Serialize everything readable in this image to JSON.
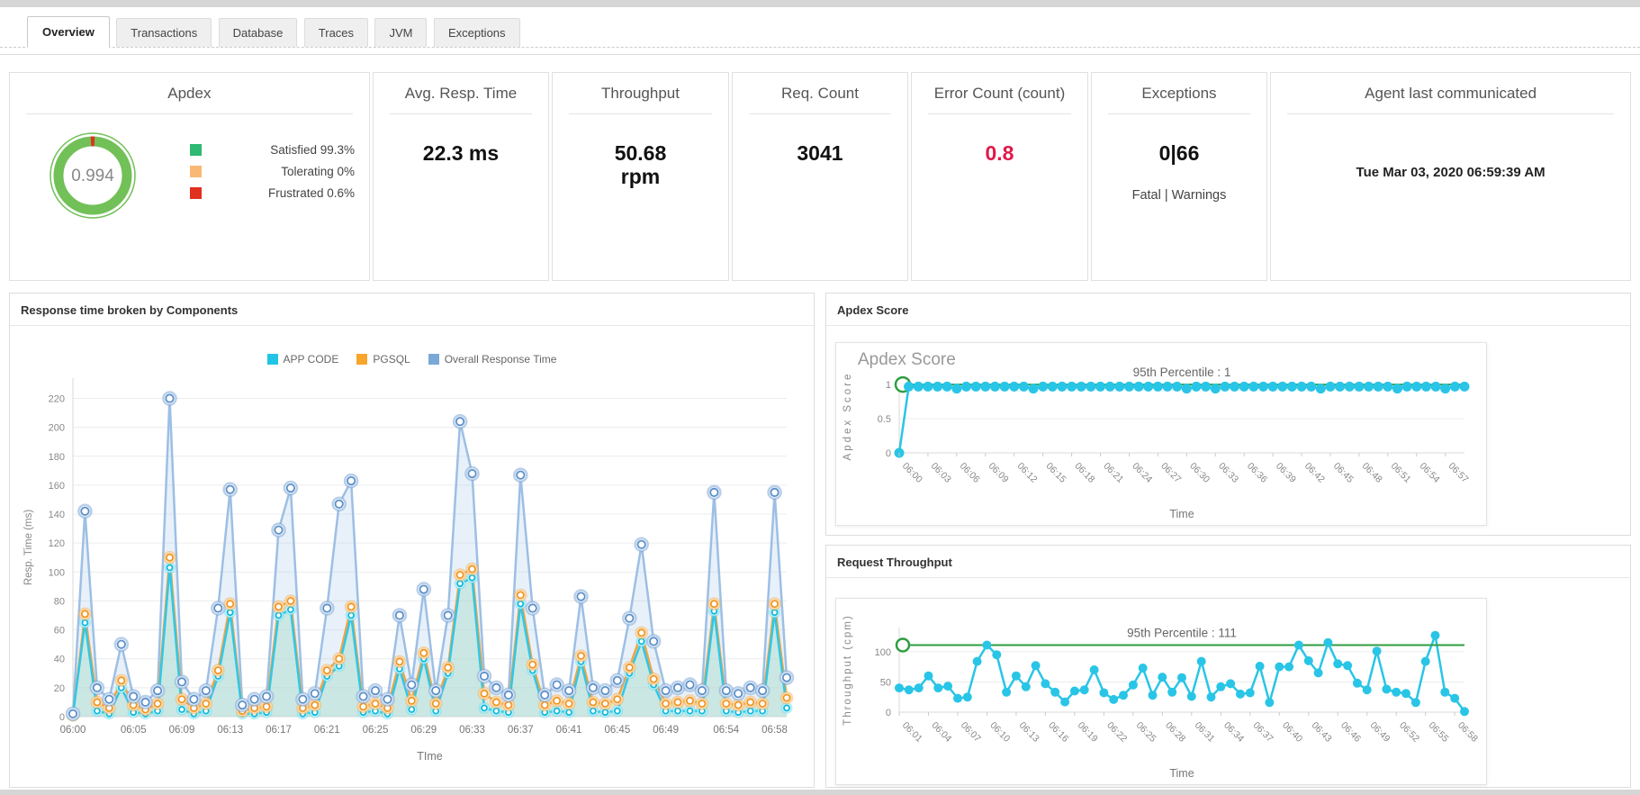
{
  "tabs": [
    {
      "label": "Overview",
      "active": true
    },
    {
      "label": "Transactions",
      "active": false
    },
    {
      "label": "Database",
      "active": false
    },
    {
      "label": "Traces",
      "active": false
    },
    {
      "label": "JVM",
      "active": false
    },
    {
      "label": "Exceptions",
      "active": false
    }
  ],
  "kpis": {
    "apdex": {
      "title": "Apdex",
      "donut": {
        "value": "0.994",
        "ring_color": "#72c058",
        "sliver_color": "#e0301e"
      },
      "legend": [
        {
          "label": "Satisfied 99.3%",
          "color": "#2eb872"
        },
        {
          "label": "Tolerating 0%",
          "color": "#f9b874"
        },
        {
          "label": "Frustrated 0.6%",
          "color": "#e0301e"
        }
      ]
    },
    "avg_resp": {
      "title": "Avg. Resp. Time",
      "value": "22.3 ms"
    },
    "throughput": {
      "title": "Throughput",
      "value": "50.68",
      "unit": "rpm"
    },
    "req_count": {
      "title": "Req. Count",
      "value": "3041"
    },
    "error_count": {
      "title": "Error Count (count)",
      "value": "0.8",
      "color": "#e0194a"
    },
    "exceptions": {
      "title": "Exceptions",
      "value": "0|66",
      "sub": "Fatal | Warnings"
    },
    "agent": {
      "title": "Agent last communicated",
      "value": "Tue Mar 03, 2020 06:59:39 AM"
    }
  },
  "panels": {
    "components": {
      "title": "Response time broken by Components"
    },
    "apdex_score": {
      "title": "Apdex Score",
      "inner_title": "Apdex Score"
    },
    "request_throughput": {
      "title": "Request Throughput"
    }
  },
  "chart_data": [
    {
      "type": "line",
      "title": "Response time broken by Components",
      "xlabel": "TIme",
      "ylabel": "Resp. Time (ms)",
      "ylim": [
        0,
        234
      ],
      "yticks": [
        0,
        20,
        40,
        60,
        80,
        100,
        120,
        140,
        160,
        180,
        200,
        220
      ],
      "grid": true,
      "legend_position": "top",
      "rotate_labels": false,
      "categories": [
        "06:00",
        "06:01",
        "06:02",
        "06:03",
        "06:04",
        "06:05",
        "06:06",
        "06:07",
        "06:08",
        "06:09",
        "06:10",
        "06:11",
        "06:12",
        "06:13",
        "06:14",
        "06:15",
        "06:16",
        "06:17",
        "06:18",
        "06:19",
        "06:20",
        "06:21",
        "06:22",
        "06:23",
        "06:24",
        "06:25",
        "06:26",
        "06:27",
        "06:28",
        "06:29",
        "06:30",
        "06:31",
        "06:32",
        "06:33",
        "06:34",
        "06:35",
        "06:36",
        "06:37",
        "06:38",
        "06:39",
        "06:40",
        "06:41",
        "06:42",
        "06:43",
        "06:44",
        "06:45",
        "06:46",
        "06:47",
        "06:48",
        "06:49",
        "06:50",
        "06:51",
        "06:52",
        "06:53",
        "06:54",
        "06:55",
        "06:56",
        "06:57",
        "06:58",
        "06:59"
      ],
      "label_indices": [
        0,
        5,
        9,
        13,
        17,
        21,
        25,
        29,
        33,
        37,
        41,
        45,
        49,
        54,
        58
      ],
      "legend": [
        {
          "name": "APP CODE",
          "color": "#22c4e6"
        },
        {
          "name": "PGSQL",
          "color": "#f7a52b"
        },
        {
          "name": "Overall Response Time",
          "color": "#7aa9d8"
        }
      ],
      "series": [
        {
          "name": "Overall Response Time",
          "color": "#9dbfe4",
          "marker": "ring",
          "marker_color": "#5a8fc8",
          "halo": "rgba(130,170,215,0.55)",
          "halo_r": 7,
          "ring_r": 4.2,
          "fill": "rgba(150,190,230,0.22)",
          "values": [
            2,
            142,
            20,
            12,
            50,
            14,
            10,
            18,
            220,
            24,
            12,
            18,
            75,
            157,
            8,
            12,
            14,
            129,
            158,
            12,
            16,
            75,
            147,
            163,
            14,
            18,
            12,
            70,
            22,
            88,
            18,
            70,
            204,
            168,
            28,
            20,
            15,
            167,
            75,
            15,
            22,
            18,
            83,
            20,
            18,
            25,
            68,
            119,
            52,
            18,
            20,
            22,
            18,
            155,
            18,
            16,
            20,
            18,
            155,
            27
          ]
        },
        {
          "name": "PGSQL",
          "color": "#f3a43f",
          "marker": "ring",
          "marker_color": "#ef9623",
          "halo": "rgba(248,175,80,0.5)",
          "halo_r": 6,
          "ring_r": 3.6,
          "fill": "rgba(250,195,120,0.28)",
          "values": [
            1,
            71,
            10,
            6,
            25,
            8,
            5,
            9,
            110,
            12,
            6,
            9,
            32,
            78,
            4,
            6,
            7,
            76,
            80,
            6,
            8,
            32,
            40,
            76,
            7,
            9,
            6,
            38,
            11,
            44,
            9,
            34,
            98,
            102,
            16,
            10,
            8,
            84,
            36,
            8,
            11,
            9,
            42,
            10,
            9,
            12,
            34,
            58,
            26,
            9,
            10,
            11,
            9,
            78,
            9,
            8,
            10,
            9,
            78,
            13
          ]
        },
        {
          "name": "APP CODE",
          "color": "#2fc8e8",
          "marker": "ring",
          "marker_color": "#10b9dd",
          "halo": "rgba(100,220,240,0.45)",
          "halo_r": 5.2,
          "ring_r": 3,
          "fill": "rgba(150,235,248,0.4)",
          "values": [
            1,
            65,
            4,
            2,
            20,
            3,
            2,
            4,
            103,
            5,
            2,
            4,
            28,
            72,
            2,
            2,
            3,
            70,
            74,
            2,
            3,
            28,
            35,
            70,
            3,
            4,
            2,
            33,
            5,
            40,
            4,
            30,
            92,
            96,
            6,
            4,
            3,
            78,
            32,
            3,
            4,
            3,
            38,
            4,
            3,
            4,
            30,
            52,
            22,
            4,
            4,
            4,
            4,
            73,
            4,
            3,
            4,
            4,
            72,
            6
          ]
        }
      ]
    },
    {
      "type": "line",
      "title": "Apdex Score",
      "xlabel": "Time",
      "ylabel": "Apdex Score",
      "ylim": [
        0,
        1.08
      ],
      "yticks": [
        0,
        0.5,
        1
      ],
      "grid": true,
      "rotate_labels": true,
      "percentile": {
        "value": 1,
        "label": "95th Percentile : 1",
        "color": "#2f9e41",
        "marker_r": 8
      },
      "categories": [
        "06:00",
        "06:01",
        "06:02",
        "06:03",
        "06:04",
        "06:05",
        "06:06",
        "06:07",
        "06:08",
        "06:09",
        "06:10",
        "06:11",
        "06:12",
        "06:13",
        "06:14",
        "06:15",
        "06:16",
        "06:17",
        "06:18",
        "06:19",
        "06:20",
        "06:21",
        "06:22",
        "06:23",
        "06:24",
        "06:25",
        "06:26",
        "06:27",
        "06:28",
        "06:29",
        "06:30",
        "06:31",
        "06:32",
        "06:33",
        "06:34",
        "06:35",
        "06:36",
        "06:37",
        "06:38",
        "06:39",
        "06:40",
        "06:41",
        "06:42",
        "06:43",
        "06:44",
        "06:45",
        "06:46",
        "06:47",
        "06:48",
        "06:49",
        "06:50",
        "06:51",
        "06:52",
        "06:53",
        "06:54",
        "06:55",
        "06:56",
        "06:57",
        "06:58",
        "06:59"
      ],
      "label_indices": [
        0,
        3,
        6,
        9,
        12,
        15,
        18,
        21,
        24,
        27,
        30,
        33,
        36,
        39,
        42,
        45,
        48,
        51,
        54,
        57
      ],
      "series": [
        {
          "name": "Apdex Score",
          "color": "#29c5e6",
          "marker": "dot",
          "marker_r": 5.5,
          "values": [
            0,
            0.97,
            0.97,
            0.97,
            0.97,
            0.97,
            0.94,
            0.97,
            0.97,
            0.97,
            0.97,
            0.97,
            0.97,
            0.97,
            0.94,
            0.97,
            0.97,
            0.97,
            0.97,
            0.97,
            0.97,
            0.97,
            0.97,
            0.97,
            0.97,
            0.97,
            0.97,
            0.97,
            0.97,
            0.97,
            0.94,
            0.97,
            0.97,
            0.94,
            0.97,
            0.97,
            0.97,
            0.97,
            0.97,
            0.97,
            0.97,
            0.97,
            0.97,
            0.97,
            0.94,
            0.97,
            0.97,
            0.97,
            0.97,
            0.97,
            0.97,
            0.97,
            0.94,
            0.97,
            0.97,
            0.97,
            0.97,
            0.94,
            0.97,
            0.97
          ]
        }
      ]
    },
    {
      "type": "line",
      "title": "Request Throughput",
      "xlabel": "Time",
      "ylabel": "Throughput (cpm)",
      "ylim": [
        0,
        140
      ],
      "yticks": [
        0,
        50,
        100
      ],
      "grid": true,
      "rotate_labels": true,
      "percentile": {
        "value": 111,
        "label": "95th Percentile : 111",
        "color": "#2f9e41",
        "marker_r": 7
      },
      "categories": [
        "06:01",
        "06:02",
        "06:03",
        "06:04",
        "06:05",
        "06:06",
        "06:07",
        "06:08",
        "06:09",
        "06:10",
        "06:11",
        "06:12",
        "06:13",
        "06:14",
        "06:15",
        "06:16",
        "06:17",
        "06:18",
        "06:19",
        "06:20",
        "06:21",
        "06:22",
        "06:23",
        "06:24",
        "06:25",
        "06:26",
        "06:27",
        "06:28",
        "06:29",
        "06:30",
        "06:31",
        "06:32",
        "06:33",
        "06:34",
        "06:35",
        "06:36",
        "06:37",
        "06:38",
        "06:39",
        "06:40",
        "06:41",
        "06:42",
        "06:43",
        "06:44",
        "06:45",
        "06:46",
        "06:47",
        "06:48",
        "06:49",
        "06:50",
        "06:51",
        "06:52",
        "06:53",
        "06:54",
        "06:55",
        "06:56",
        "06:57",
        "06:58",
        "06:59"
      ],
      "label_indices": [
        0,
        3,
        6,
        9,
        12,
        15,
        18,
        21,
        24,
        27,
        30,
        33,
        36,
        39,
        42,
        45,
        48,
        51,
        54,
        57
      ],
      "series": [
        {
          "name": "Request Throughput",
          "color": "#29c5e6",
          "marker": "dot",
          "marker_r": 5,
          "values": [
            40,
            37,
            40,
            60,
            40,
            43,
            23,
            25,
            84,
            111,
            95,
            33,
            60,
            42,
            77,
            47,
            33,
            17,
            35,
            37,
            70,
            32,
            21,
            28,
            45,
            73,
            28,
            58,
            33,
            57,
            26,
            84,
            25,
            42,
            47,
            30,
            32,
            76,
            16,
            75,
            75,
            111,
            85,
            65,
            115,
            80,
            77,
            48,
            37,
            101,
            38,
            33,
            31,
            16,
            84,
            127,
            33,
            23,
            1
          ]
        }
      ]
    }
  ]
}
